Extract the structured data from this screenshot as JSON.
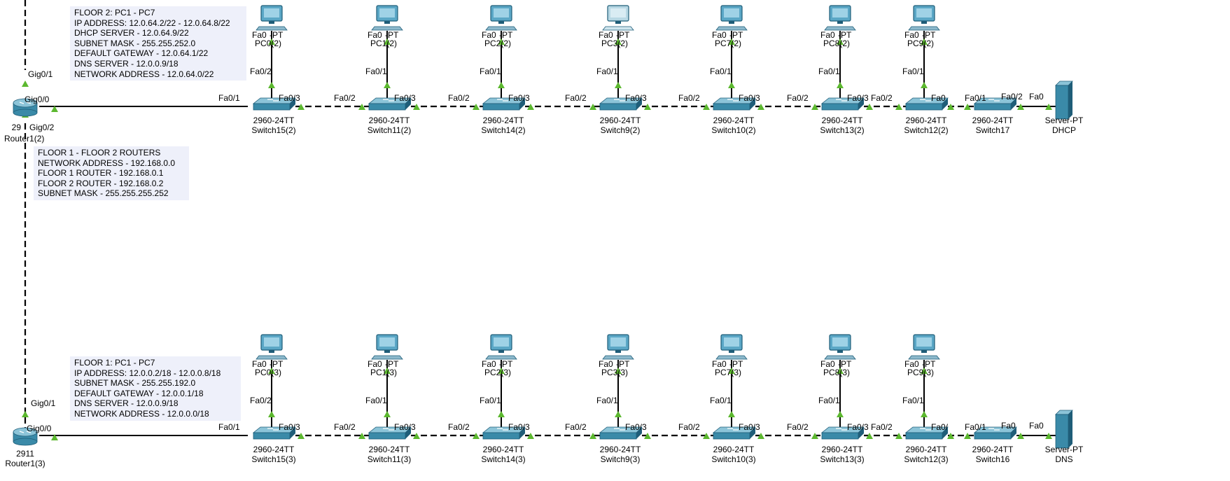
{
  "notes": {
    "floor2": {
      "lines": [
        "FLOOR 2: PC1 - PC7",
        "IP ADDRESS: 12.0.64.2/22 - 12.0.64.8/22",
        "DHCP SERVER - 12.0.64.9/22",
        "SUBNET MASK - 255.255.252.0",
        "DEFAULT GATEWAY - 12.0.64.1/22",
        "DNS SERVER - 12.0.0.9/18",
        "NETWORK ADDRESS - 12.0.64.0/22"
      ]
    },
    "routers": {
      "lines": [
        "FLOOR 1 - FLOOR 2 ROUTERS",
        "NETWORK ADDRESS - 192.168.0.0",
        "FLOOR 1 ROUTER - 192.168.0.1",
        "FLOOR 2 ROUTER - 192.168.0.2",
        "SUBNET MASK - 255.255.255.252"
      ]
    },
    "floor1": {
      "lines": [
        "FLOOR 1: PC1 - PC7",
        "IP ADDRESS: 12.0.0.2/18 - 12.0.0.8/18",
        "SUBNET MASK - 255.255.192.0",
        "DEFAULT GATEWAY - 12.0.0.1/18",
        "DNS SERVER - 12.0.0.9/18",
        "NETWORK ADDRESS - 12.0.0.0/18"
      ]
    }
  },
  "routers": {
    "floor2": {
      "model": "29",
      "name": "Router1(2)",
      "ports": [
        "Gig0/1",
        "Gig0/0",
        "Gig0/2"
      ]
    },
    "floor1": {
      "model": "2911",
      "name": "Router1(3)",
      "ports": [
        "Gig0/1",
        "Gig0/0"
      ]
    }
  },
  "floor2": {
    "switches": [
      {
        "model": "2960-24TT",
        "name": "Switch15(2)",
        "left_port": "Fa0/1",
        "right_port": "Fa0/3",
        "up_port": "Fa0/2",
        "pc": {
          "fa": "Fa0",
          "pt": "-PT",
          "name": "PC0(2)"
        }
      },
      {
        "model": "2960-24TT",
        "name": "Switch11(2)",
        "left_port": "Fa0/2",
        "right_port": "Fa0/3",
        "up_port": "Fa0/1",
        "pc": {
          "fa": "Fa0",
          "pt": "-PT",
          "name": "PC1(2)"
        }
      },
      {
        "model": "2960-24TT",
        "name": "Switch14(2)",
        "left_port": "Fa0/2",
        "right_port": "Fa0/3",
        "up_port": "Fa0/1",
        "pc": {
          "fa": "Fa0",
          "pt": "-PT",
          "name": "PC2(2)"
        }
      },
      {
        "model": "2960-24TT",
        "name": "Switch9(2)",
        "left_port": "Fa0/2",
        "right_port": "Fa0/3",
        "up_port": "Fa0/1",
        "pc": {
          "fa": "Fa0",
          "pt": "-PT",
          "name": "PC3(2)"
        }
      },
      {
        "model": "2960-24TT",
        "name": "Switch10(2)",
        "left_port": "Fa0/2",
        "right_port": "Fa0/3",
        "up_port": "Fa0/1",
        "pc": {
          "fa": "Fa0",
          "pt": "-PT",
          "name": "PC7(2)"
        }
      },
      {
        "model": "2960-24TT",
        "name": "Switch13(2)",
        "left_port": "Fa0/2",
        "right_port": "Fa0/3",
        "up_port": "Fa0/1",
        "pc": {
          "fa": "Fa0",
          "pt": "-PT",
          "name": "PC8(2)"
        }
      },
      {
        "model": "2960-24TT",
        "name": "Switch12(2)",
        "left_port": "Fa0/2",
        "right_port": "Fa0",
        "up_port": "Fa0/1",
        "pc": {
          "fa": "Fa0",
          "pt": "-PT",
          "name": "PC9(2)"
        }
      }
    ],
    "edge_switch": {
      "model": "2960-24TT",
      "name": "Switch17",
      "left_port": "Fa0/1",
      "right_port": "Fa0/2"
    },
    "server": {
      "port": "Fa0",
      "model": "Server-PT",
      "name": "DHCP"
    }
  },
  "floor1": {
    "switches": [
      {
        "model": "2960-24TT",
        "name": "Switch15(3)",
        "left_port": "Fa0/1",
        "right_port": "Fa0/3",
        "up_port": "Fa0/2",
        "pc": {
          "fa": "Fa0",
          "pt": "-PT",
          "name": "PC0(3)"
        }
      },
      {
        "model": "2960-24TT",
        "name": "Switch11(3)",
        "left_port": "Fa0/2",
        "right_port": "Fa0/3",
        "up_port": "Fa0/1",
        "pc": {
          "fa": "Fa0",
          "pt": "-PT",
          "name": "PC1(3)"
        }
      },
      {
        "model": "2960-24TT",
        "name": "Switch14(3)",
        "left_port": "Fa0/2",
        "right_port": "Fa0/3",
        "up_port": "Fa0/1",
        "pc": {
          "fa": "Fa0",
          "pt": "-PT",
          "name": "PC2(3)"
        }
      },
      {
        "model": "2960-24TT",
        "name": "Switch9(3)",
        "left_port": "Fa0/2",
        "right_port": "Fa0/3",
        "up_port": "Fa0/1",
        "pc": {
          "fa": "Fa0",
          "pt": "-PT",
          "name": "PC3(3)"
        }
      },
      {
        "model": "2960-24TT",
        "name": "Switch10(3)",
        "left_port": "Fa0/2",
        "right_port": "Fa0/3",
        "up_port": "Fa0/1",
        "pc": {
          "fa": "Fa0",
          "pt": "-PT",
          "name": "PC7(3)"
        }
      },
      {
        "model": "2960-24TT",
        "name": "Switch13(3)",
        "left_port": "Fa0/2",
        "right_port": "Fa0/3",
        "up_port": "Fa0/1",
        "pc": {
          "fa": "Fa0",
          "pt": "-PT",
          "name": "PC8(3)"
        }
      },
      {
        "model": "2960-24TT",
        "name": "Switch12(3)",
        "left_port": "Fa0/2",
        "right_port": "Fa0/",
        "up_port": "Fa0/1",
        "pc": {
          "fa": "Fa0",
          "pt": "-PT",
          "name": "PC9(3)"
        }
      }
    ],
    "edge_switch": {
      "model": "2960-24TT",
      "name": "Switch16",
      "left_port": "Fa0/1",
      "right_port": "Fa0"
    },
    "server": {
      "port": "Fa0",
      "model": "Server-PT",
      "name": "DNS"
    }
  },
  "colors": {
    "link": "#000000",
    "port_up": "#5cb82f",
    "device": "#3a8aa8",
    "device_dark": "#1f5d78",
    "device_light": "#8cc4d8",
    "pc_screen": "#5ba7c6",
    "pc_inactive": "#b8d8e4",
    "note_bg": "#eef0fa"
  }
}
